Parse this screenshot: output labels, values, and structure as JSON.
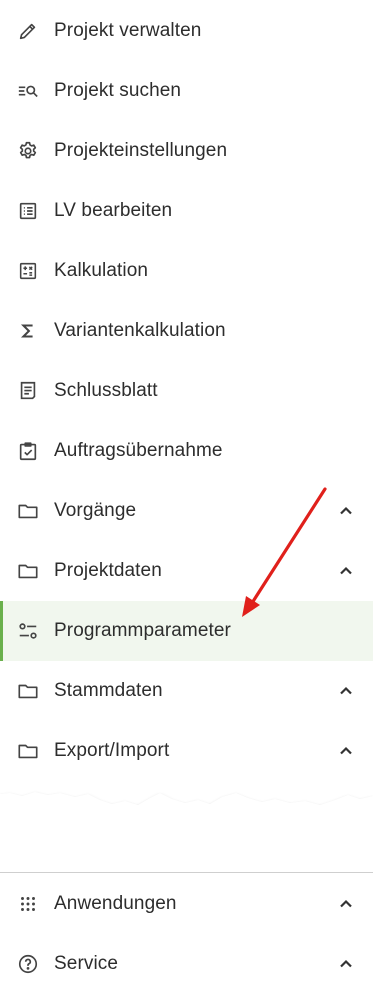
{
  "menu": {
    "items": [
      {
        "label": "Projekt verwalten",
        "icon": "pencil-icon"
      },
      {
        "label": "Projekt suchen",
        "icon": "search-list-icon"
      },
      {
        "label": "Projekteinstellungen",
        "icon": "gear-icon"
      },
      {
        "label": "LV bearbeiten",
        "icon": "list-document-icon"
      },
      {
        "label": "Kalkulation",
        "icon": "calculator-icon"
      },
      {
        "label": "Variantenkalkulation",
        "icon": "sigma-icon"
      },
      {
        "label": "Schlussblatt",
        "icon": "receipt-icon"
      },
      {
        "label": "Auftragsübernahme",
        "icon": "clipboard-check-icon"
      },
      {
        "label": "Vorgänge",
        "icon": "folder-icon"
      },
      {
        "label": "Projektdaten",
        "icon": "folder-icon"
      },
      {
        "label": "Programmparameter",
        "icon": "settings-sliders-icon"
      },
      {
        "label": "Stammdaten",
        "icon": "folder-icon"
      },
      {
        "label": "Export/Import",
        "icon": "folder-icon"
      }
    ]
  },
  "bottom": {
    "items": [
      {
        "label": "Anwendungen",
        "icon": "apps-grid-icon"
      },
      {
        "label": "Service",
        "icon": "help-circle-icon"
      }
    ]
  },
  "colors": {
    "active_background": "#f1f7ee",
    "active_indicator": "#6ab04c",
    "annotation_arrow": "#e0201b"
  }
}
